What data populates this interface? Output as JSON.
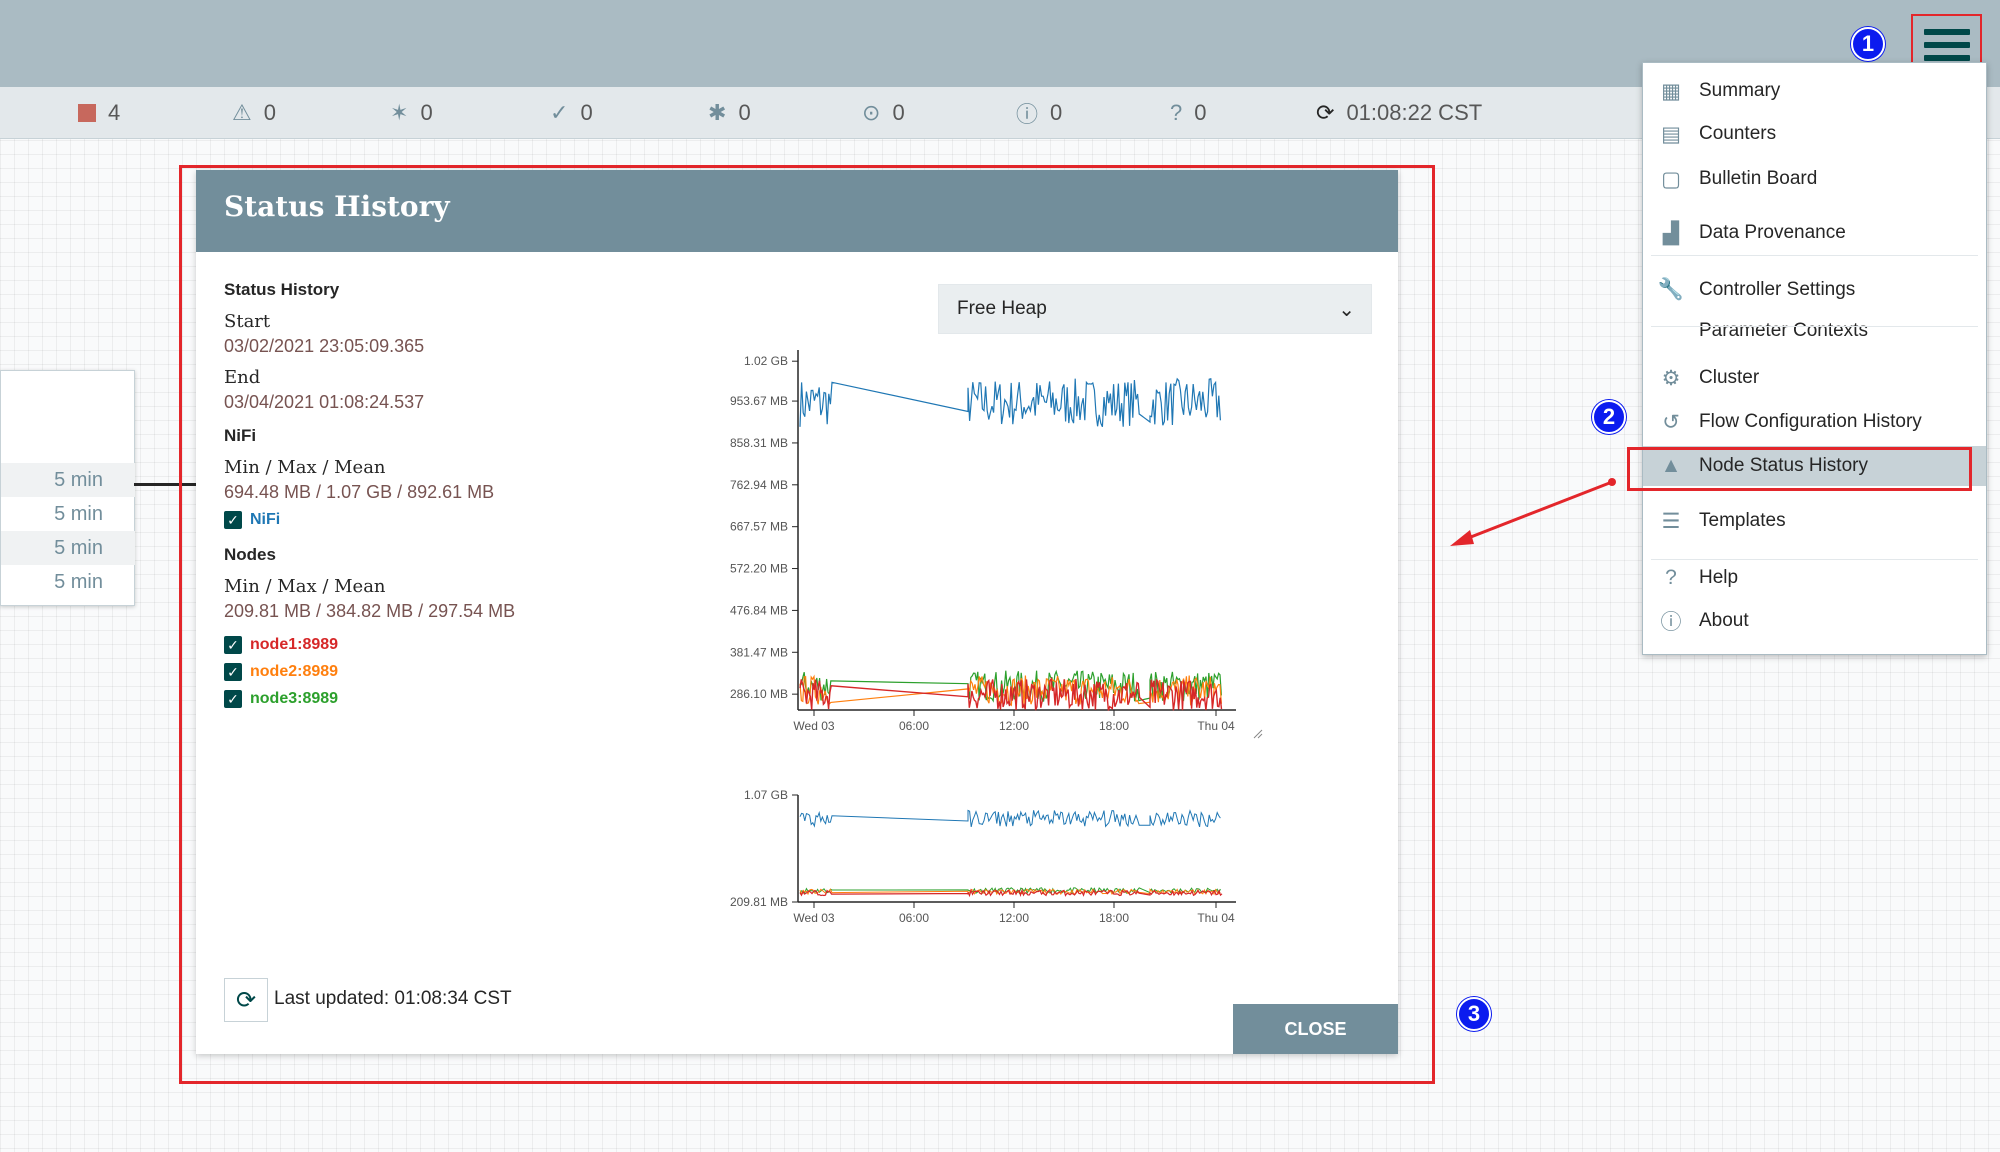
{
  "stats": {
    "stopped": "4",
    "invalid": "0",
    "disabled": "0",
    "up_to_date": "0",
    "locally_modified": "0",
    "stale": "0",
    "locally_modified_stale": "0",
    "sync_failure": "0",
    "refresh_time": "01:08:22 CST"
  },
  "global_menu": {
    "items": [
      {
        "label": "Summary",
        "icon": "table-icon"
      },
      {
        "label": "Counters",
        "icon": "counter-icon"
      },
      {
        "label": "Bulletin Board",
        "icon": "sticky-note-icon"
      },
      {
        "label": "Data Provenance",
        "icon": "provenance-icon"
      },
      {
        "label": "Controller Settings",
        "icon": "wrench-icon"
      },
      {
        "label": "Parameter Contexts",
        "icon": ""
      },
      {
        "label": "Cluster",
        "icon": "cluster-icon"
      },
      {
        "label": "Flow Configuration History",
        "icon": "history-icon"
      },
      {
        "label": "Node Status History",
        "icon": "area-chart-icon"
      },
      {
        "label": "Templates",
        "icon": "templates-icon"
      },
      {
        "label": "Help",
        "icon": "question-circle-icon"
      },
      {
        "label": "About",
        "icon": "info-circle-icon"
      }
    ]
  },
  "callouts": [
    "1",
    "2",
    "3"
  ],
  "left_panel": {
    "rows": [
      "5 min",
      "5 min",
      "5 min",
      "5 min"
    ]
  },
  "dialog": {
    "title": "Status History",
    "section_title": "Status History",
    "start_label": "Start",
    "start_value": "03/02/2021 23:05:09.365",
    "end_label": "End",
    "end_value": "03/04/2021 01:08:24.537",
    "nifi_title": "NiFi",
    "nifi_mmm_label": "Min / Max / Mean",
    "nifi_mmm_value": "694.48 MB / 1.07 GB / 892.61 MB",
    "nifi_checkbox": "NiFi",
    "nodes_title": "Nodes",
    "nodes_mmm_label": "Min / Max / Mean",
    "nodes_mmm_value": "209.81 MB / 384.82 MB / 297.54 MB",
    "node_checkboxes": [
      "node1:8989",
      "node2:8989",
      "node3:8989"
    ],
    "metric_select": "Free Heap",
    "last_updated": "Last updated: 01:08:34 CST",
    "close_label": "CLOSE"
  },
  "colors": {
    "nifi": "#1f77b4",
    "node1": "#d62728",
    "node2": "#ff7f0e",
    "node3": "#2ca02c",
    "accent": "#728e9b",
    "highlight": "#e3262b"
  },
  "chart_data": [
    {
      "type": "line",
      "title": "",
      "ylabel": "",
      "xlabel": "",
      "y_ticks": [
        "1.02 GB",
        "953.67 MB",
        "858.31 MB",
        "762.94 MB",
        "667.57 MB",
        "572.20 MB",
        "476.84 MB",
        "381.47 MB",
        "286.10 MB"
      ],
      "x_ticks": [
        "Wed 03",
        "06:00",
        "12:00",
        "18:00",
        "Thu 04"
      ],
      "ylim_mb": [
        250,
        1070
      ],
      "series": [
        {
          "name": "NiFi",
          "approx_range_mb": [
            900,
            1000
          ]
        },
        {
          "name": "node1:8989",
          "approx_range_mb": [
            250,
            330
          ]
        },
        {
          "name": "node2:8989",
          "approx_range_mb": [
            260,
            330
          ]
        },
        {
          "name": "node3:8989",
          "approx_range_mb": [
            270,
            340
          ]
        }
      ]
    },
    {
      "type": "line",
      "title": "",
      "y_ticks": [
        "1.07 GB",
        "209.81 MB"
      ],
      "x_ticks": [
        "Wed 03",
        "06:00",
        "12:00",
        "18:00",
        "Thu 04"
      ],
      "series": [
        {
          "name": "NiFi"
        },
        {
          "name": "node1:8989"
        },
        {
          "name": "node2:8989"
        },
        {
          "name": "node3:8989"
        }
      ]
    }
  ]
}
